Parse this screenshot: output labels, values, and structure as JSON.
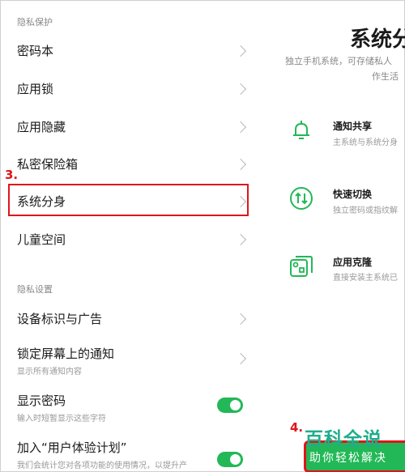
{
  "left": {
    "section_privacy": "隐私保护",
    "items": [
      {
        "label": "密码本"
      },
      {
        "label": "应用锁"
      },
      {
        "label": "应用隐藏"
      },
      {
        "label": "私密保险箱"
      },
      {
        "label": "系统分身"
      },
      {
        "label": "儿童空间"
      }
    ],
    "section_settings": "隐私设置",
    "settings": [
      {
        "label": "设备标识与广告"
      },
      {
        "label": "锁定屏幕上的通知",
        "sub": "显示所有通知内容"
      },
      {
        "label": "显示密码",
        "sub": "输入时短暂显示这些字符",
        "toggle": "on"
      },
      {
        "label": "加入“用户体验计划”",
        "sub": "我们会统计您对各项功能的使用情况，以提升产",
        "toggle": "on"
      }
    ],
    "step3": "3.",
    "step4": "4."
  },
  "right": {
    "title": "系统分",
    "desc_line1": "独立手机系统，可存储私人",
    "desc_line2": "作生活",
    "features": [
      {
        "icon": "bell-icon",
        "title": "通知共享",
        "sub": "主系统与系统分身"
      },
      {
        "icon": "switch-icon",
        "title": "快速切换",
        "sub": "独立密码或指纹解"
      },
      {
        "icon": "app-clone-icon",
        "title": "应用克隆",
        "sub": "直接安装主系统已"
      }
    ]
  },
  "watermark": {
    "title": "百科全说",
    "sub": "助你轻松解决"
  },
  "colors": {
    "accent": "#22b857",
    "annotation": "#e0141a"
  }
}
